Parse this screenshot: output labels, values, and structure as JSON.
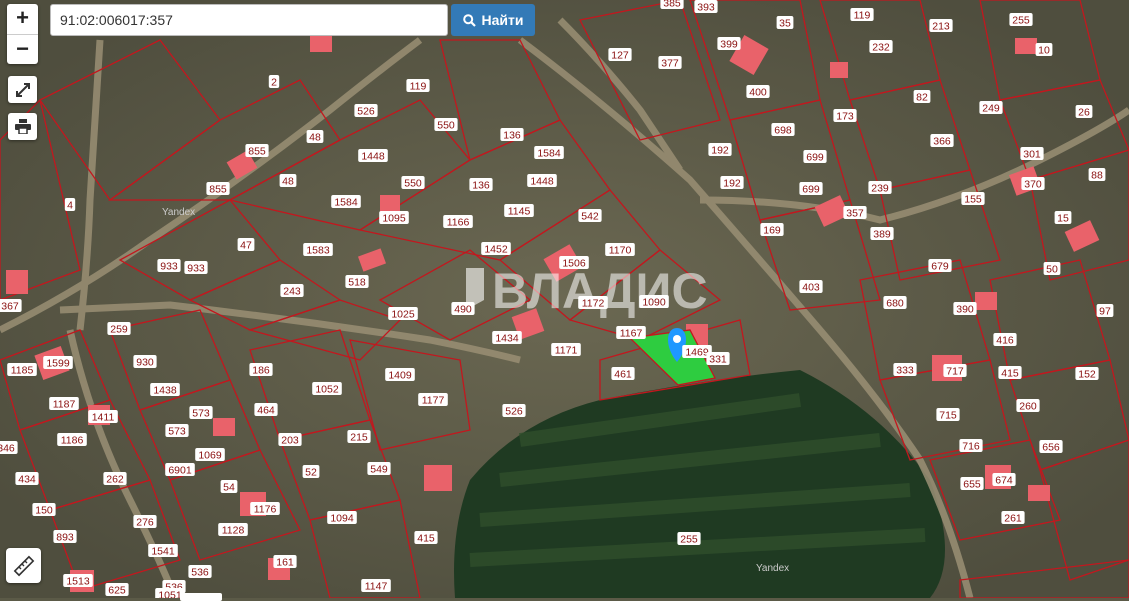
{
  "search": {
    "value": "91:02:006017:357",
    "button_label": "Найти"
  },
  "controls": {
    "zoom_in": "+",
    "zoom_out": "−"
  },
  "watermark": "ВЛАДИС",
  "yandex_label": "Yandex",
  "highlight_color": "#2ecc40",
  "border_color": "#c3171e",
  "map_labels": [
    "385",
    "393",
    "35",
    "119",
    "213",
    "255",
    "232",
    "127",
    "377",
    "399",
    "2",
    "10",
    "26",
    "119",
    "526",
    "400",
    "82",
    "249",
    "173",
    "698",
    "366",
    "136",
    "550",
    "48",
    "855",
    "1584",
    "1448",
    "192",
    "699",
    "301",
    "370",
    "88",
    "48",
    "855",
    "550",
    "136",
    "1448",
    "192",
    "239",
    "155",
    "4",
    "1584",
    "1095",
    "1145",
    "699",
    "357",
    "15",
    "542",
    "1166",
    "389",
    "169",
    "47",
    "1583",
    "1170",
    "1452",
    "1506",
    "933",
    "933",
    "679",
    "50",
    "243",
    "518",
    "1167",
    "403",
    "1090",
    "680",
    "390",
    "97",
    "259",
    "1025",
    "490",
    "1434",
    "1172",
    "416",
    "367",
    "1171",
    "461",
    "1469",
    "331",
    "930",
    "1599",
    "186",
    "1409",
    "333",
    "717",
    "415",
    "152",
    "1185",
    "1438",
    "1052",
    "1177",
    "526",
    "464",
    "715",
    "260",
    "1187",
    "573",
    "203",
    "215",
    "1411",
    "1186",
    "1069",
    "573",
    "716",
    "656",
    "346",
    "6901",
    "52",
    "549",
    "434",
    "262",
    "54",
    "655",
    "674",
    "150",
    "1176",
    "1094",
    "261",
    "893",
    "276",
    "1128",
    "415",
    "255",
    "1541",
    "161",
    "1513",
    "536",
    "536",
    "1147",
    "625",
    "1051"
  ]
}
